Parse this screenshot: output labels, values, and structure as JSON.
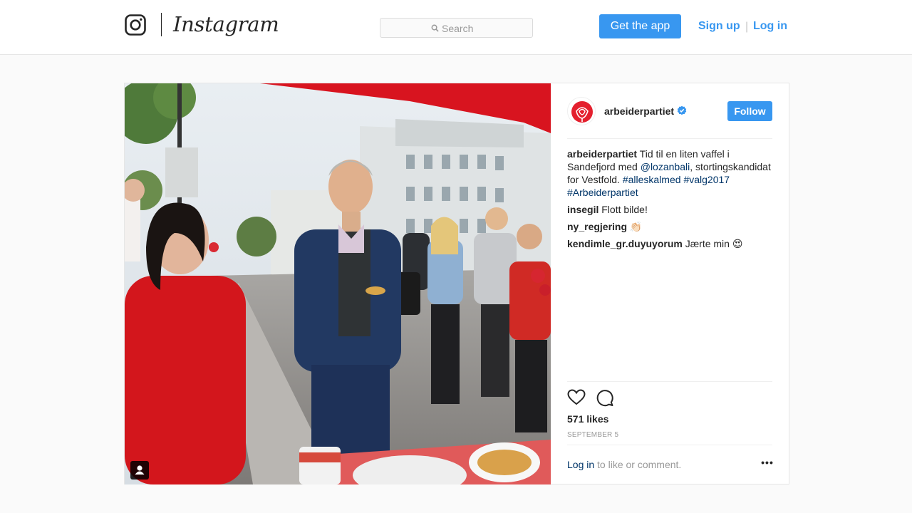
{
  "header": {
    "brand": "Instagram",
    "search_placeholder": "Search",
    "get_app_label": "Get the app",
    "signup_label": "Sign up",
    "separator": "|",
    "login_label": "Log in"
  },
  "post": {
    "owner": "arbeiderpartiet",
    "follow_label": "Follow",
    "caption": {
      "author": "arbeiderpartiet",
      "text_1": " Tid til en liten vaffel i Sandefjord med ",
      "mention": "@lozanbali",
      "text_2": ", stortingskandidat for Vestfold. ",
      "hashtag_1": "#alleskalmed",
      "hashtag_2": "#valg2017",
      "hashtag_3": "#Arbeiderpartiet"
    },
    "comments": [
      {
        "author": "insegil",
        "text": " Flott bilde!"
      },
      {
        "author": "ny_regjering",
        "text": " 👏🏻"
      },
      {
        "author": "kendimle_gr.duyuyorum",
        "text": " Jærte min 😍"
      }
    ],
    "likes": "571 likes",
    "date": "SEPTEMBER 5",
    "footer_login": "Log in",
    "footer_rest": " to like or comment.",
    "more_label": "•••"
  },
  "colors": {
    "accent": "#3897f0",
    "link": "#003569",
    "muted": "#999999",
    "brand_red": "#e4202e"
  }
}
